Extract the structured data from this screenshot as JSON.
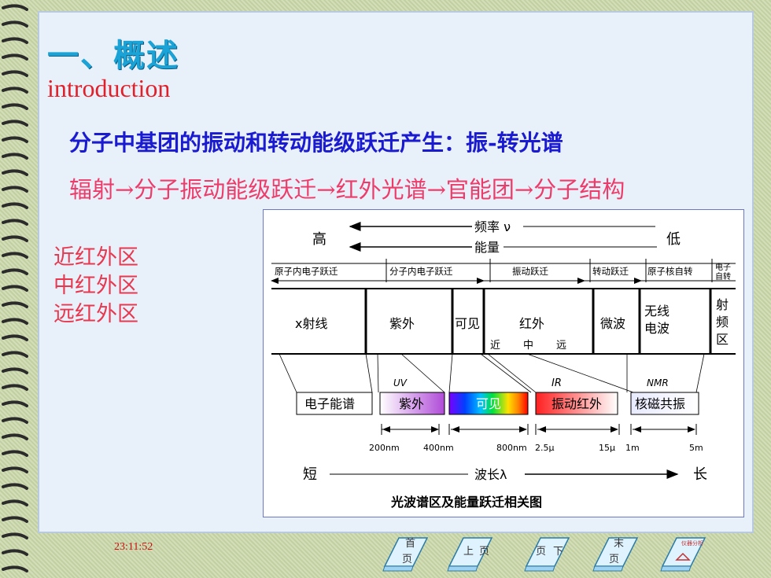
{
  "slide": {
    "title": "一、概述",
    "subtitle": "introduction",
    "line1": "分子中基团的振动和转动能级跃迁产生：振-转光谱",
    "line2": "辐射→分子振动能级跃迁→红外光谱→官能团→分子结构",
    "regions": [
      "近红外区",
      "中红外区",
      "远红外区"
    ],
    "timestamp": "23:11:52"
  },
  "figure": {
    "freq_label": "频率 ν",
    "energy_label": "能量",
    "high": "高",
    "low": "低",
    "transitions": [
      "原子内电子跃迁",
      "分子内电子跃迁",
      "振动跃迁",
      "转动跃迁",
      "原子核自转",
      "电子自转"
    ],
    "regions": [
      "x射线",
      "紫外",
      "可见",
      "红外",
      "微波",
      "无线电波",
      "射频区"
    ],
    "ir_sub": [
      "近",
      "中",
      "远"
    ],
    "uv_tag": "UV",
    "ir_tag": "IR",
    "nmr_tag": "NMR",
    "spectra": [
      "电子能谱",
      "紫外",
      "可见",
      "振动红外",
      "核磁共振"
    ],
    "ticks": [
      "200nm",
      "400nm",
      "800nm",
      "2.5μ",
      "15μ",
      "1m",
      "5m"
    ],
    "short": "短",
    "wavelength_label": "波长λ",
    "long": "长",
    "caption": "光波谱区及能量跃迁相关图"
  },
  "nav": {
    "first": [
      "首",
      "页"
    ],
    "prev": [
      "上",
      "页"
    ],
    "next": [
      "页",
      "下"
    ],
    "last": [
      "末",
      "页"
    ],
    "home_badge": "仪器分析"
  }
}
